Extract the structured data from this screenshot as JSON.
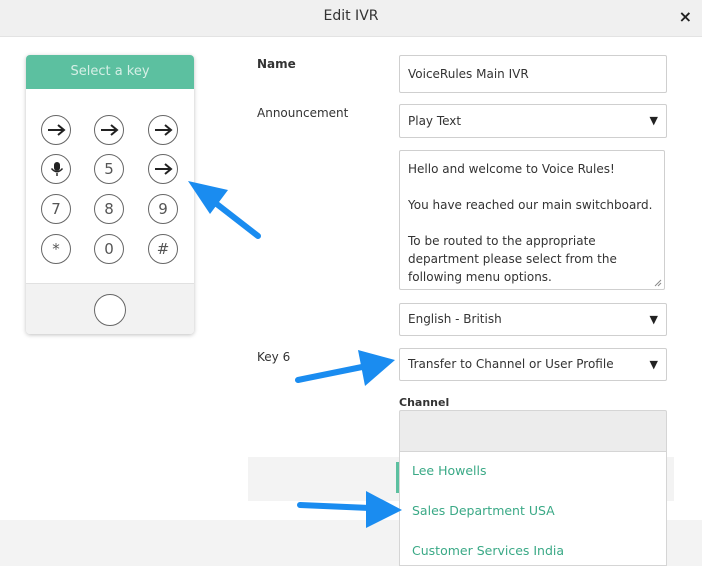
{
  "dialog": {
    "title": "Edit IVR",
    "close_icon": "×"
  },
  "keypad": {
    "header": "Select a key",
    "keys": [
      "→",
      "→",
      "→",
      "mic",
      "5",
      "→",
      "7",
      "8",
      "9",
      "*",
      "0",
      "#"
    ]
  },
  "form": {
    "name_label": "Name",
    "name_value": "VoiceRules Main IVR",
    "announcement_label": "Announcement",
    "announcement_value": "Play Text",
    "text_lines": [
      "Hello and welcome to Voice Rules!",
      "You have reached our main switchboard.",
      "To be routed to the appropriate department please select from the following menu options."
    ],
    "language_value": "English - British",
    "key_label": "Key 6",
    "key_action_value": "Transfer to Channel or User Profile",
    "channel_label": "Channel",
    "channel_options": [
      "Lee Howells",
      "Sales Department USA",
      "Customer Services India"
    ]
  },
  "colors": {
    "accent": "#5cc0a0",
    "link": "#3aa986",
    "annotation": "#1a8cf0"
  }
}
